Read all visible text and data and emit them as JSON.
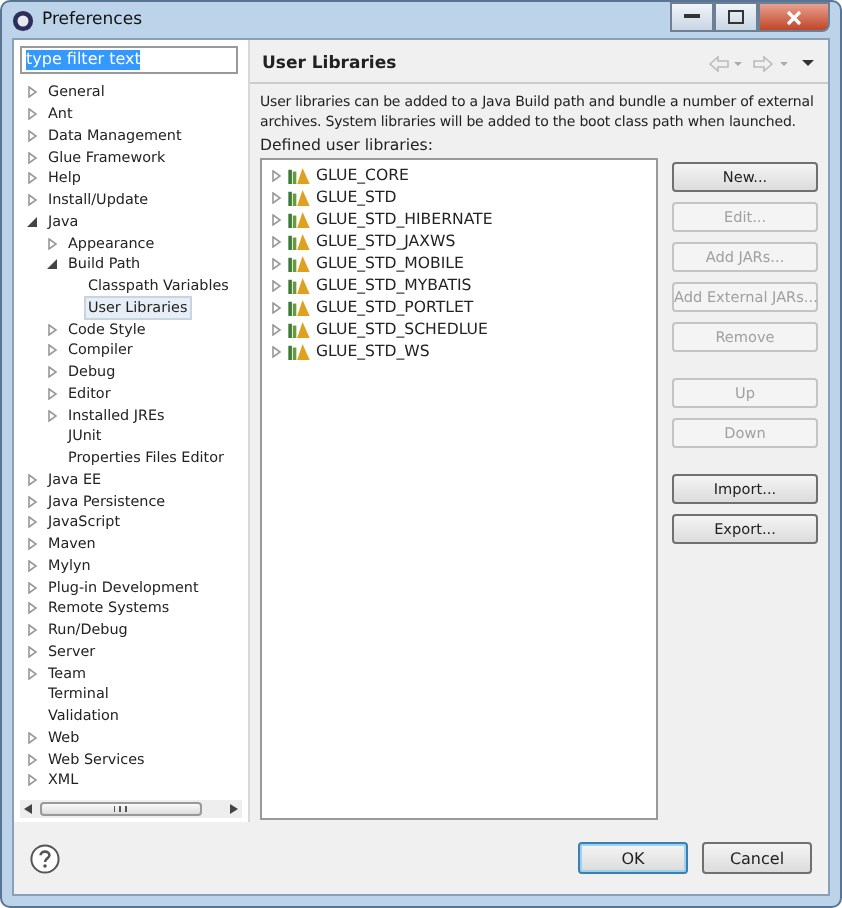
{
  "window": {
    "title": "Preferences"
  },
  "filter": {
    "value": "type filter text"
  },
  "tree": [
    {
      "label": "General",
      "expanded": false,
      "selected": false
    },
    {
      "label": "Ant",
      "expanded": false,
      "selected": false
    },
    {
      "label": "Data Management",
      "expanded": false,
      "selected": false
    },
    {
      "label": "Glue Framework",
      "expanded": false,
      "selected": false
    },
    {
      "label": "Help",
      "expanded": false,
      "selected": false
    },
    {
      "label": "Install/Update",
      "expanded": false,
      "selected": false
    },
    {
      "label": "Java",
      "expanded": true,
      "selected": false,
      "children": [
        {
          "label": "Appearance",
          "expanded": false,
          "selected": false
        },
        {
          "label": "Build Path",
          "expanded": true,
          "selected": false,
          "children": [
            {
              "label": "Classpath Variables",
              "selected": false
            },
            {
              "label": "User Libraries",
              "selected": true
            }
          ]
        },
        {
          "label": "Code Style",
          "expanded": false,
          "selected": false
        },
        {
          "label": "Compiler",
          "expanded": false,
          "selected": false
        },
        {
          "label": "Debug",
          "expanded": false,
          "selected": false
        },
        {
          "label": "Editor",
          "expanded": false,
          "selected": false
        },
        {
          "label": "Installed JREs",
          "expanded": false,
          "selected": false
        },
        {
          "label": "JUnit",
          "selected": false
        },
        {
          "label": "Properties Files Editor",
          "selected": false
        }
      ]
    },
    {
      "label": "Java EE",
      "expanded": false,
      "selected": false
    },
    {
      "label": "Java Persistence",
      "expanded": false,
      "selected": false
    },
    {
      "label": "JavaScript",
      "expanded": false,
      "selected": false
    },
    {
      "label": "Maven",
      "expanded": false,
      "selected": false
    },
    {
      "label": "Mylyn",
      "expanded": false,
      "selected": false
    },
    {
      "label": "Plug-in Development",
      "expanded": false,
      "selected": false
    },
    {
      "label": "Remote Systems",
      "expanded": false,
      "selected": false
    },
    {
      "label": "Run/Debug",
      "expanded": false,
      "selected": false
    },
    {
      "label": "Server",
      "expanded": false,
      "selected": false
    },
    {
      "label": "Team",
      "expanded": false,
      "selected": false
    },
    {
      "label": "Terminal",
      "selected": false
    },
    {
      "label": "Validation",
      "selected": false
    },
    {
      "label": "Web",
      "expanded": false,
      "selected": false
    },
    {
      "label": "Web Services",
      "expanded": false,
      "selected": false
    },
    {
      "label": "XML",
      "expanded": false,
      "selected": false
    }
  ],
  "page": {
    "title": "User Libraries",
    "description": "User libraries can be added to a Java Build path and bundle a number of external archives. System libraries will be added to the boot class path when launched.",
    "list_label": "Defined user libraries:"
  },
  "libraries": [
    {
      "name": "GLUE_CORE",
      "expanded": false
    },
    {
      "name": "GLUE_STD",
      "expanded": false
    },
    {
      "name": "GLUE_STD_HIBERNATE",
      "expanded": false
    },
    {
      "name": "GLUE_STD_JAXWS",
      "expanded": false
    },
    {
      "name": "GLUE_STD_MOBILE",
      "expanded": false
    },
    {
      "name": "GLUE_STD_MYBATIS",
      "expanded": false
    },
    {
      "name": "GLUE_STD_PORTLET",
      "expanded": false
    },
    {
      "name": "GLUE_STD_SCHEDLUE",
      "expanded": false
    },
    {
      "name": "GLUE_STD_WS",
      "expanded": false
    }
  ],
  "button_groups": [
    [
      {
        "label": "New...",
        "disabled": false
      },
      {
        "label": "Edit...",
        "disabled": true
      },
      {
        "label": "Add JARs...",
        "disabled": true
      },
      {
        "label": "Add External JARs...",
        "disabled": true
      },
      {
        "label": "Remove",
        "disabled": true
      }
    ],
    [
      {
        "label": "Up",
        "disabled": true
      },
      {
        "label": "Down",
        "disabled": true
      }
    ],
    [
      {
        "label": "Import...",
        "disabled": false
      },
      {
        "label": "Export...",
        "disabled": false
      }
    ]
  ],
  "footer": {
    "ok": "OK",
    "cancel": "Cancel"
  }
}
